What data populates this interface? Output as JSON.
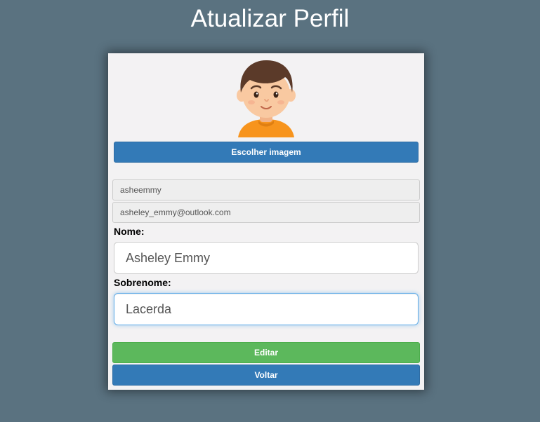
{
  "page": {
    "title": "Atualizar Perfil"
  },
  "profile": {
    "avatar_icon": "cartoon-boy-avatar",
    "choose_image_label": "Escolher imagem",
    "username": "asheemmy",
    "email": "asheley_emmy@outlook.com",
    "first_name_label": "Nome:",
    "first_name_value": "Asheley Emmy",
    "last_name_label": "Sobrenome:",
    "last_name_value": "Lacerda",
    "edit_label": "Editar",
    "back_label": "Voltar"
  },
  "colors": {
    "background": "#5a7280",
    "card": "#f3f2f3",
    "primary_blue": "#337ab7",
    "success_green": "#5cb85c",
    "avatar_shirt": "#f7941d",
    "avatar_hair": "#5b3a29"
  }
}
